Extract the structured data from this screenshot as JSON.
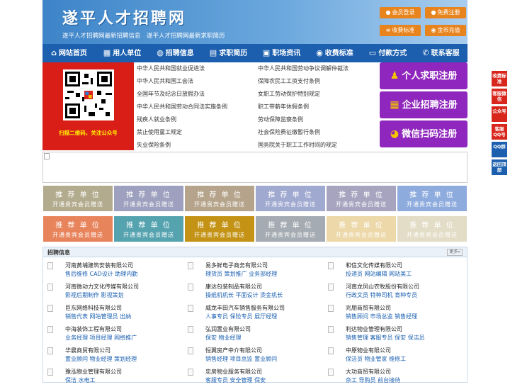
{
  "header": {
    "logo": "遂平人才招聘网",
    "slogan": "遂平人才招聘网最新招聘信息　遂平人才招聘网最新求职简历",
    "buttons": [
      {
        "label": "会员登录",
        "icon": "user-icon"
      },
      {
        "label": "免费注册",
        "icon": "user-icon"
      },
      {
        "label": "收费标准",
        "icon": "list-icon"
      },
      {
        "label": "金币充值",
        "icon": "coin-icon"
      }
    ]
  },
  "nav": [
    {
      "label": "网站首页",
      "icon": "home-icon"
    },
    {
      "label": "用人单位",
      "icon": "building-icon"
    },
    {
      "label": "招聘信息",
      "icon": "people-icon"
    },
    {
      "label": "求职简历",
      "icon": "resume-icon"
    },
    {
      "label": "职场资讯",
      "icon": "news-icon"
    },
    {
      "label": "收费标准",
      "icon": "coin-icon"
    },
    {
      "label": "付款方式",
      "icon": "card-icon"
    },
    {
      "label": "联系客服",
      "icon": "phone-icon"
    }
  ],
  "qr": {
    "caption": "扫描二维码，关注公众号"
  },
  "links": {
    "left": [
      "中华人民共和国就业促进法",
      "中华人民共和国工会法",
      "全国年节及纪念日放假办法",
      "中华人民共和国劳动合同法实施条例",
      "残疾人就业条例",
      "禁止使用童工规定",
      "失业保险条例"
    ],
    "right": [
      "中华人民共和国劳动争议调解仲裁法",
      "保障农民工工资支付条例",
      "女职工劳动保护特别规定",
      "职工带薪年休假条例",
      "劳动保障监察条例",
      "社会保险费征缴暂行条例",
      "国务院关于职工工作时间的规定"
    ]
  },
  "register": [
    {
      "label": "个人求职注册",
      "icon": "person-icon"
    },
    {
      "label": "企业招聘注册",
      "icon": "company-icon"
    },
    {
      "label": "微信扫码注册",
      "icon": "wechat-icon"
    }
  ],
  "recommend": {
    "title": "推 荐 单 位",
    "sub": "开通贵宾会员赠送",
    "row1": [
      "#b3ab8e",
      "#9da0be",
      "#b5a48b",
      "#a0a9cf",
      "#a6a4bf",
      "#8eabde"
    ],
    "row2": [
      "#e8845c",
      "#56a3b0",
      "#c49316",
      "#a4abb2",
      "#ecd8a8",
      "#e3dcc6"
    ]
  },
  "jobs": {
    "title": "招聘信息",
    "more": "更多»",
    "items": [
      {
        "company": "河南黄埔建筑安装有限公司",
        "positions": "售后维修 CAD设计 助理内勤"
      },
      {
        "company": "易多鲜电子商务有限公司",
        "positions": "理货员 策划推广 业务部经理"
      },
      {
        "company": "和信文化传媒有限公司",
        "positions": "投递员 网站编辑 网站美工"
      },
      {
        "company": "河南微动力文化传媒有限公司",
        "positions": "影视后期制作 影视策划"
      },
      {
        "company": "康达包装制品有限公司",
        "positions": "操纸机机长 平面设计 烫金机长"
      },
      {
        "company": "河南龙凤山农牧股份有限公司",
        "positions": "行政文员 特种司机 育种专员"
      },
      {
        "company": "巨东网络科技有限公司",
        "positions": "销售代表 网站管理员 出纳"
      },
      {
        "company": "威龙丰田汽车销售服务有限公司",
        "positions": "人事专员 保险专员 展厅经理"
      },
      {
        "company": "兆朋商贸有限公司",
        "positions": "销售顾问 市场总监 销售经理"
      },
      {
        "company": "中海装饰工程有限公司",
        "positions": "业务经理 项目经理 网络推广"
      },
      {
        "company": "弘润置业有限公司",
        "positions": "保安 物业经理"
      },
      {
        "company": "利达物业管理有限公司",
        "positions": "销售管理 客服专员 保安 保洁员"
      },
      {
        "company": "华晨商贸有限公司",
        "positions": "置业顾问 物业经理 策划经理"
      },
      {
        "company": "恒翼房产中介有限公司",
        "positions": "销售经理 项目总监 置业顾问"
      },
      {
        "company": "中原物业有限公司",
        "positions": "保洁员 物业管家 维修工"
      },
      {
        "company": "豫泓物业管理有限公司",
        "positions": "保洁 水电工"
      },
      {
        "company": "忠房物业服务有限公司",
        "positions": "客服专员 安全管理 保安"
      },
      {
        "company": "大功商贸有限公司",
        "positions": "杂工 导购员 前台接待"
      }
    ]
  },
  "side": [
    {
      "label": "收费标准",
      "color": "#d9261c"
    },
    {
      "label": "客服微信",
      "color": "#d9261c"
    },
    {
      "label": "公众号",
      "color": "#d9261c"
    },
    {
      "label": "客服QQ号",
      "color": "#d9261c"
    },
    {
      "label": "QQ群",
      "color": "#1c5fae"
    },
    {
      "label": "返回顶部",
      "color": "#1c5fae"
    }
  ]
}
